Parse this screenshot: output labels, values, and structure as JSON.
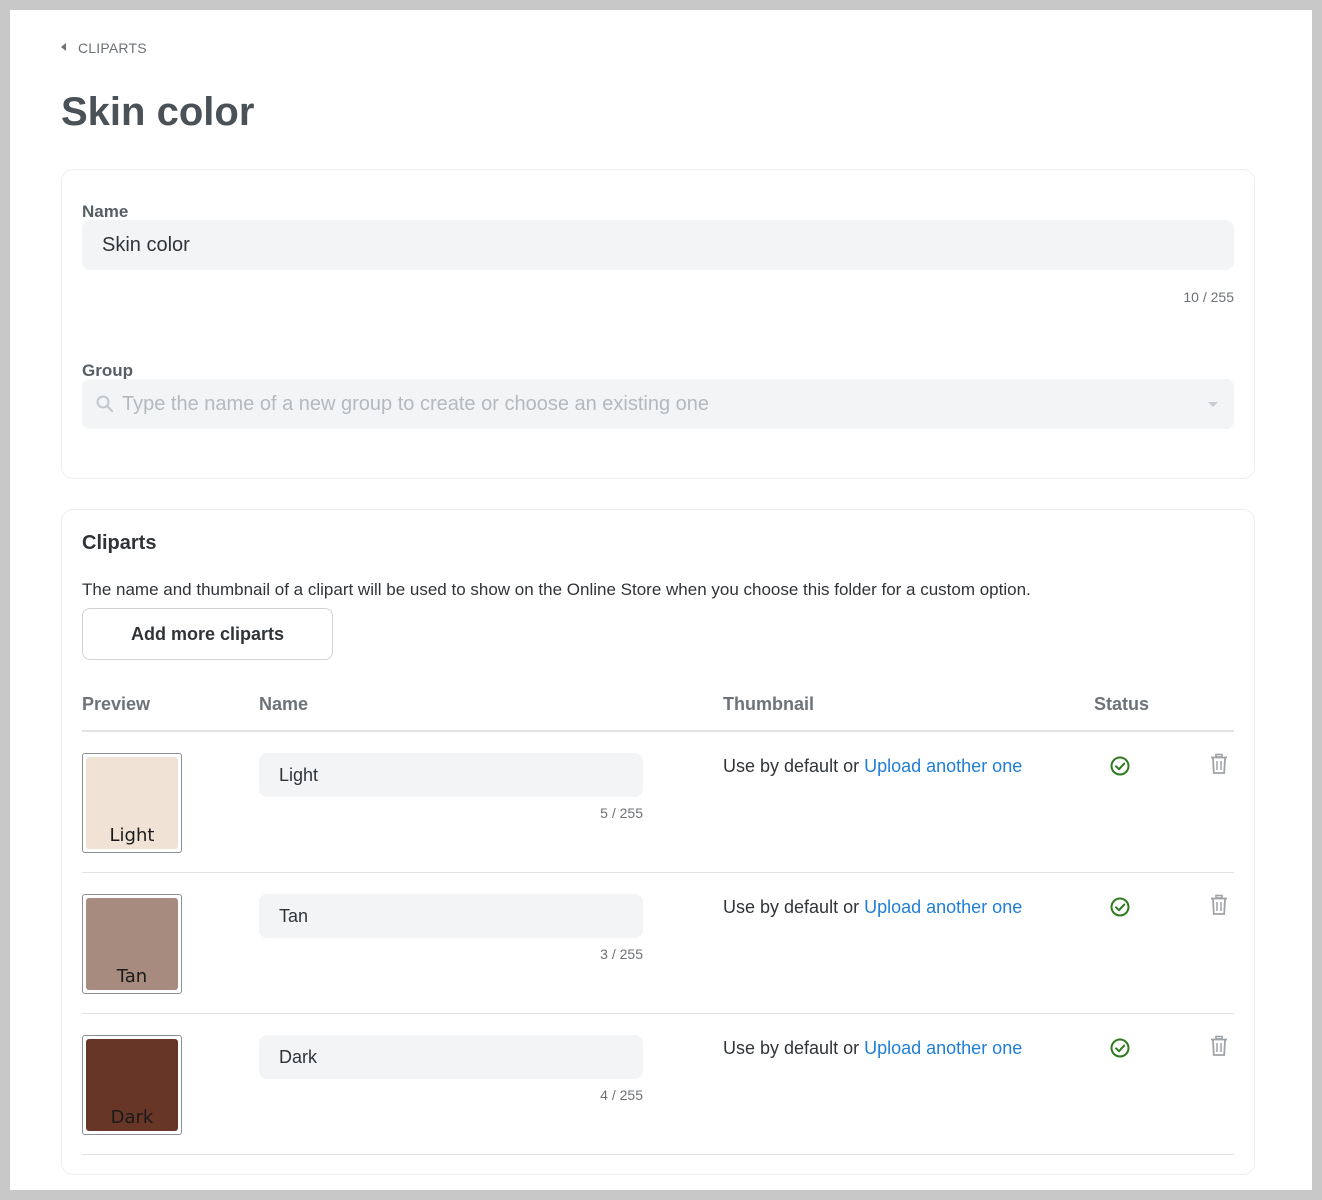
{
  "breadcrumb": {
    "label": "CLIPARTS"
  },
  "page": {
    "title": "Skin color"
  },
  "details": {
    "name_label": "Name",
    "name_value": "Skin color",
    "name_counter": "10 / 255",
    "group_label": "Group",
    "group_placeholder": "Type the name of a new group to create or choose an existing one"
  },
  "cliparts": {
    "title": "Cliparts",
    "description": "The name and thumbnail of a clipart will be used to show on the Online Store when you choose this folder for a custom option.",
    "add_button": "Add more cliparts",
    "columns": {
      "preview": "Preview",
      "name": "Name",
      "thumbnail": "Thumbnail",
      "status": "Status"
    },
    "rows": [
      {
        "preview_label": "Light",
        "preview_color": "#f0e3d6",
        "name": "Light",
        "counter": "5 / 255",
        "thumb_prefix": "Use by default or",
        "thumb_link": "Upload another one",
        "status": "active",
        "status_icon": "check-circle-icon"
      },
      {
        "preview_label": "Tan",
        "preview_color": "#a78b7e",
        "name": "Tan",
        "counter": "3 / 255",
        "thumb_prefix": "Use by default or",
        "thumb_link": "Upload another one",
        "status": "active",
        "status_icon": "check-circle-icon"
      },
      {
        "preview_label": "Dark",
        "preview_color": "#683627",
        "name": "Dark",
        "counter": "4 / 255",
        "thumb_prefix": "Use by default or",
        "thumb_link": "Upload another one",
        "status": "active",
        "status_icon": "check-circle-icon"
      }
    ]
  },
  "colors": {
    "link": "#1f7ed6",
    "status_ok": "#2f7a1f",
    "title": "#4a5258"
  }
}
